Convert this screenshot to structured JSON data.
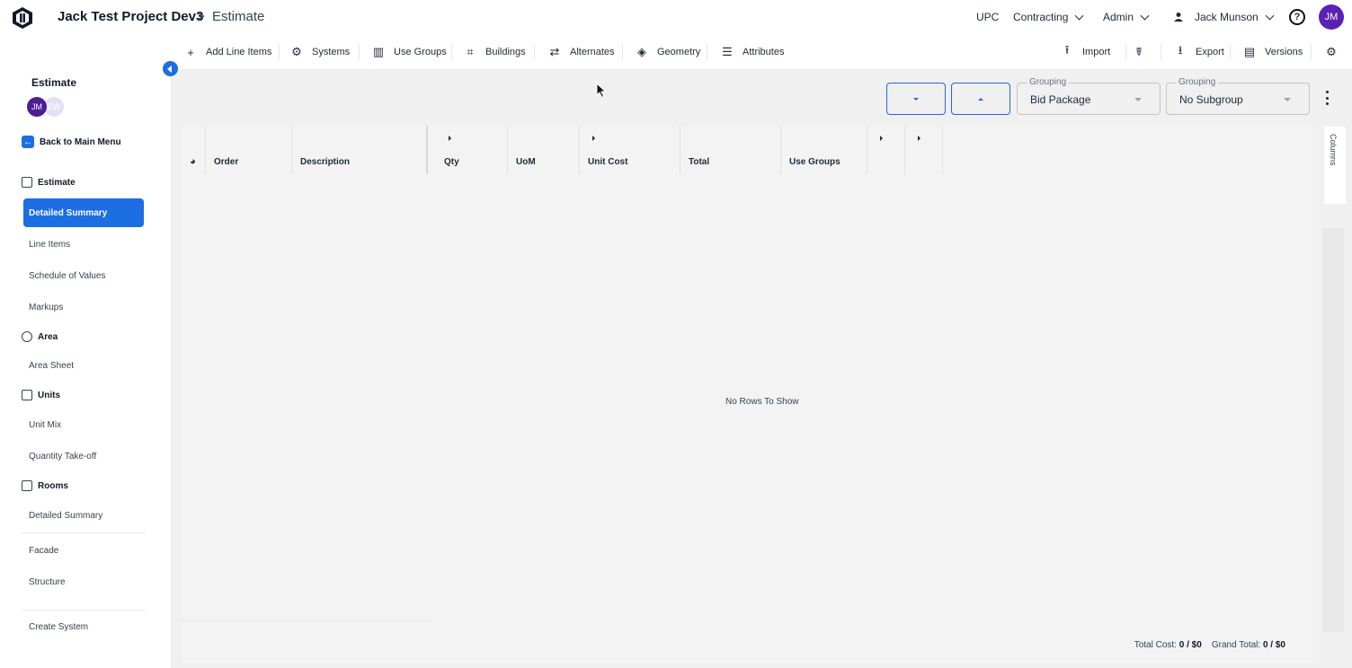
{
  "header": {
    "project": "Jack Test Project Dev3",
    "separator": ">",
    "page": "Estimate",
    "upc": "UPC",
    "contracting": "Contracting",
    "admin": "Admin",
    "user": "Jack Munson",
    "help": "?",
    "avatar": "JM"
  },
  "toolbar": {
    "add_line_items": "Add Line Items",
    "systems": "Systems",
    "use_groups": "Use Groups",
    "buildings": "Buildings",
    "alternates": "Alternates",
    "geometry": "Geometry",
    "attributes": "Attributes",
    "import": "Import",
    "export": "Export",
    "versions": "Versions"
  },
  "sidebar": {
    "title": "Estimate",
    "avatar1": "JM",
    "avatar2": "EW",
    "back": "Back to Main Menu",
    "estimate_section": "Estimate",
    "detailed_summary": "Detailed Summary",
    "line_items": "Line Items",
    "schedule_of_values": "Schedule of Values",
    "markups": "Markups",
    "area_section": "Area",
    "area_sheet": "Area Sheet",
    "units_section": "Units",
    "unit_mix": "Unit Mix",
    "quantity_takeoff": "Quantity Take-off",
    "rooms_section": "Rooms",
    "rooms_detailed_summary": "Detailed Summary",
    "facade": "Facade",
    "structure": "Structure",
    "create_system": "Create System"
  },
  "controls": {
    "grouping_label": "Grouping",
    "grouping_value": "Bid Package",
    "subgroup_label": "Grouping",
    "subgroup_value": "No Subgroup"
  },
  "grid": {
    "columns": [
      "Order",
      "Description",
      "Qty",
      "UoM",
      "Unit Cost",
      "Total",
      "Use Groups"
    ],
    "empty": "No Rows To Show",
    "columns_tab": "Columns",
    "total_cost_label": "Total Cost:",
    "total_cost_value": "0 / $0",
    "grand_total_label": "Grand Total:",
    "grand_total_value": "0 / $0"
  },
  "colors": {
    "accent": "#1d6de3",
    "avatar": "#5b21b6"
  }
}
